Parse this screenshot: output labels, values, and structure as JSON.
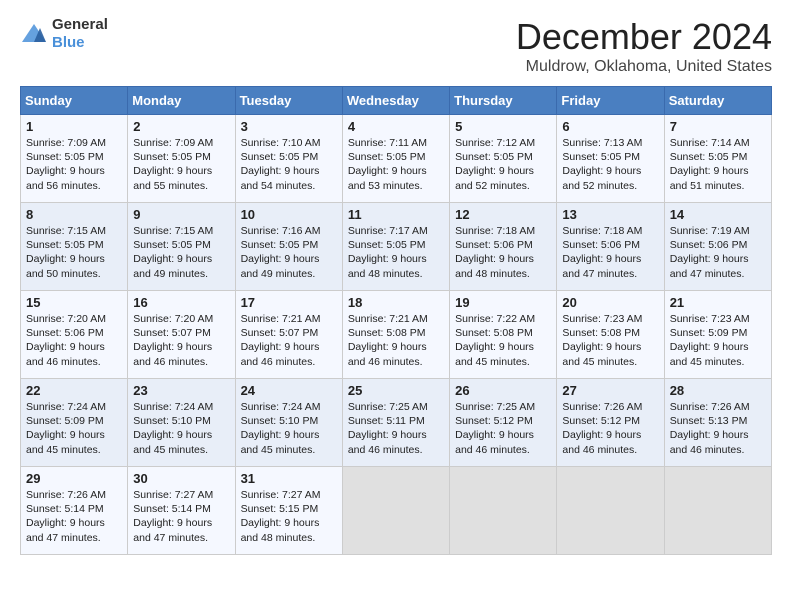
{
  "header": {
    "logo_general": "General",
    "logo_blue": "Blue",
    "month": "December 2024",
    "location": "Muldrow, Oklahoma, United States"
  },
  "days_of_week": [
    "Sunday",
    "Monday",
    "Tuesday",
    "Wednesday",
    "Thursday",
    "Friday",
    "Saturday"
  ],
  "weeks": [
    [
      {
        "day": "1",
        "info": "Sunrise: 7:09 AM\nSunset: 5:05 PM\nDaylight: 9 hours and 56 minutes."
      },
      {
        "day": "2",
        "info": "Sunrise: 7:09 AM\nSunset: 5:05 PM\nDaylight: 9 hours and 55 minutes."
      },
      {
        "day": "3",
        "info": "Sunrise: 7:10 AM\nSunset: 5:05 PM\nDaylight: 9 hours and 54 minutes."
      },
      {
        "day": "4",
        "info": "Sunrise: 7:11 AM\nSunset: 5:05 PM\nDaylight: 9 hours and 53 minutes."
      },
      {
        "day": "5",
        "info": "Sunrise: 7:12 AM\nSunset: 5:05 PM\nDaylight: 9 hours and 52 minutes."
      },
      {
        "day": "6",
        "info": "Sunrise: 7:13 AM\nSunset: 5:05 PM\nDaylight: 9 hours and 52 minutes."
      },
      {
        "day": "7",
        "info": "Sunrise: 7:14 AM\nSunset: 5:05 PM\nDaylight: 9 hours and 51 minutes."
      }
    ],
    [
      {
        "day": "8",
        "info": "Sunrise: 7:15 AM\nSunset: 5:05 PM\nDaylight: 9 hours and 50 minutes."
      },
      {
        "day": "9",
        "info": "Sunrise: 7:15 AM\nSunset: 5:05 PM\nDaylight: 9 hours and 49 minutes."
      },
      {
        "day": "10",
        "info": "Sunrise: 7:16 AM\nSunset: 5:05 PM\nDaylight: 9 hours and 49 minutes."
      },
      {
        "day": "11",
        "info": "Sunrise: 7:17 AM\nSunset: 5:05 PM\nDaylight: 9 hours and 48 minutes."
      },
      {
        "day": "12",
        "info": "Sunrise: 7:18 AM\nSunset: 5:06 PM\nDaylight: 9 hours and 48 minutes."
      },
      {
        "day": "13",
        "info": "Sunrise: 7:18 AM\nSunset: 5:06 PM\nDaylight: 9 hours and 47 minutes."
      },
      {
        "day": "14",
        "info": "Sunrise: 7:19 AM\nSunset: 5:06 PM\nDaylight: 9 hours and 47 minutes."
      }
    ],
    [
      {
        "day": "15",
        "info": "Sunrise: 7:20 AM\nSunset: 5:06 PM\nDaylight: 9 hours and 46 minutes."
      },
      {
        "day": "16",
        "info": "Sunrise: 7:20 AM\nSunset: 5:07 PM\nDaylight: 9 hours and 46 minutes."
      },
      {
        "day": "17",
        "info": "Sunrise: 7:21 AM\nSunset: 5:07 PM\nDaylight: 9 hours and 46 minutes."
      },
      {
        "day": "18",
        "info": "Sunrise: 7:21 AM\nSunset: 5:08 PM\nDaylight: 9 hours and 46 minutes."
      },
      {
        "day": "19",
        "info": "Sunrise: 7:22 AM\nSunset: 5:08 PM\nDaylight: 9 hours and 45 minutes."
      },
      {
        "day": "20",
        "info": "Sunrise: 7:23 AM\nSunset: 5:08 PM\nDaylight: 9 hours and 45 minutes."
      },
      {
        "day": "21",
        "info": "Sunrise: 7:23 AM\nSunset: 5:09 PM\nDaylight: 9 hours and 45 minutes."
      }
    ],
    [
      {
        "day": "22",
        "info": "Sunrise: 7:24 AM\nSunset: 5:09 PM\nDaylight: 9 hours and 45 minutes."
      },
      {
        "day": "23",
        "info": "Sunrise: 7:24 AM\nSunset: 5:10 PM\nDaylight: 9 hours and 45 minutes."
      },
      {
        "day": "24",
        "info": "Sunrise: 7:24 AM\nSunset: 5:10 PM\nDaylight: 9 hours and 45 minutes."
      },
      {
        "day": "25",
        "info": "Sunrise: 7:25 AM\nSunset: 5:11 PM\nDaylight: 9 hours and 46 minutes."
      },
      {
        "day": "26",
        "info": "Sunrise: 7:25 AM\nSunset: 5:12 PM\nDaylight: 9 hours and 46 minutes."
      },
      {
        "day": "27",
        "info": "Sunrise: 7:26 AM\nSunset: 5:12 PM\nDaylight: 9 hours and 46 minutes."
      },
      {
        "day": "28",
        "info": "Sunrise: 7:26 AM\nSunset: 5:13 PM\nDaylight: 9 hours and 46 minutes."
      }
    ],
    [
      {
        "day": "29",
        "info": "Sunrise: 7:26 AM\nSunset: 5:14 PM\nDaylight: 9 hours and 47 minutes."
      },
      {
        "day": "30",
        "info": "Sunrise: 7:27 AM\nSunset: 5:14 PM\nDaylight: 9 hours and 47 minutes."
      },
      {
        "day": "31",
        "info": "Sunrise: 7:27 AM\nSunset: 5:15 PM\nDaylight: 9 hours and 48 minutes."
      },
      {
        "day": "",
        "info": ""
      },
      {
        "day": "",
        "info": ""
      },
      {
        "day": "",
        "info": ""
      },
      {
        "day": "",
        "info": ""
      }
    ]
  ]
}
